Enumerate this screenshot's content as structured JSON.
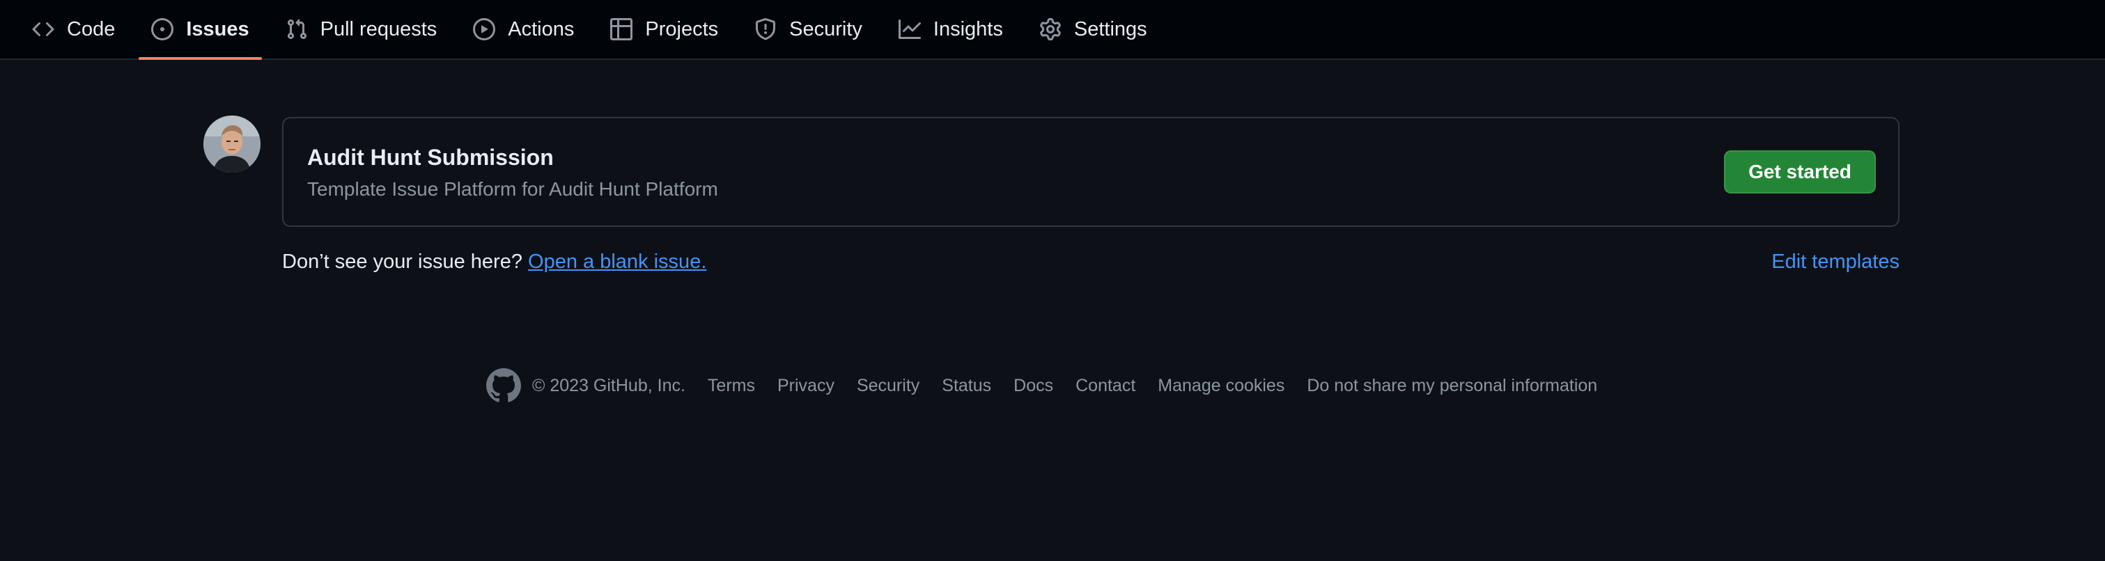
{
  "nav": {
    "tabs": [
      {
        "label": "Code",
        "icon": "code-icon",
        "selected": false
      },
      {
        "label": "Issues",
        "icon": "issue-opened-icon",
        "selected": true
      },
      {
        "label": "Pull requests",
        "icon": "git-pull-request-icon",
        "selected": false
      },
      {
        "label": "Actions",
        "icon": "play-icon",
        "selected": false
      },
      {
        "label": "Projects",
        "icon": "table-icon",
        "selected": false
      },
      {
        "label": "Security",
        "icon": "shield-icon",
        "selected": false
      },
      {
        "label": "Insights",
        "icon": "graph-icon",
        "selected": false
      },
      {
        "label": "Settings",
        "icon": "gear-icon",
        "selected": false
      }
    ],
    "selected_underline_color": "#f78166"
  },
  "template": {
    "title": "Audit Hunt Submission",
    "description": "Template Issue Platform for Audit Hunt Platform",
    "button_label": "Get started",
    "button_color": "#238636"
  },
  "blank_issue": {
    "prompt": "Don’t see your issue here?",
    "link_label": "Open a blank issue.",
    "edit_label": "Edit templates"
  },
  "footer": {
    "logo_icon": "github-mark-icon",
    "copyright": "© 2023 GitHub, Inc.",
    "links": [
      "Terms",
      "Privacy",
      "Security",
      "Status",
      "Docs",
      "Contact",
      "Manage cookies",
      "Do not share my personal information"
    ]
  },
  "colors": {
    "background": "#0d1117",
    "header_background": "#010409",
    "link": "#4493f8",
    "muted_text": "#8d96a0"
  }
}
